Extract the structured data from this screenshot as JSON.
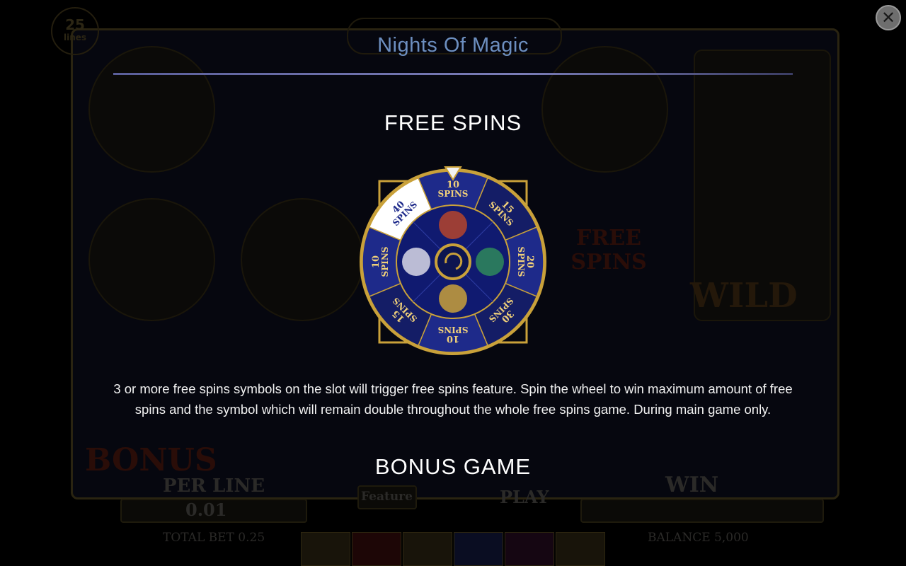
{
  "background": {
    "lines_count": "25",
    "lines_label": "lines",
    "game_logo": "Nights Of Magic",
    "per_line_label": "PER LINE",
    "per_line_value": "0.01",
    "feature_label": "Feature",
    "play_label": "PLAY",
    "win_label": "WIN",
    "total_bet": "TOTAL BET 0.25",
    "balance": "BALANCE 5,000",
    "bonus_symbol": "BONUS",
    "free_spins_symbol": "FREE SPINS",
    "wild_symbol": "WILD"
  },
  "header": {
    "title": "Nights Of Magic",
    "close_icon": "close-icon"
  },
  "sections": {
    "free_spins": {
      "heading": "FREE SPINS",
      "description": "3 or more free spins symbols on the slot will trigger free spins feature. Spin the wheel to win maximum amount of free spins and the symbol which will remain double throughout the whole free spins game. During main game only."
    },
    "bonus_game": {
      "heading": "BONUS GAME"
    }
  },
  "wheel": {
    "segments": [
      {
        "num": "10",
        "word": "SPINS",
        "highlight": false
      },
      {
        "num": "15",
        "word": "SPINS",
        "highlight": false
      },
      {
        "num": "20",
        "word": "SPINS",
        "highlight": false
      },
      {
        "num": "30",
        "word": "SPINS",
        "highlight": false
      },
      {
        "num": "10",
        "word": "SPINS",
        "highlight": false
      },
      {
        "num": "15",
        "word": "SPINS",
        "highlight": false
      },
      {
        "num": "10",
        "word": "SPINS",
        "highlight": false
      },
      {
        "num": "40",
        "word": "SPINS",
        "highlight": true
      }
    ],
    "colors": {
      "rim": "#c9a13a",
      "segment": "#1e2a8a",
      "segment_dark": "#141d66",
      "highlight": "#ffffff",
      "text": "#f0d07a"
    }
  }
}
